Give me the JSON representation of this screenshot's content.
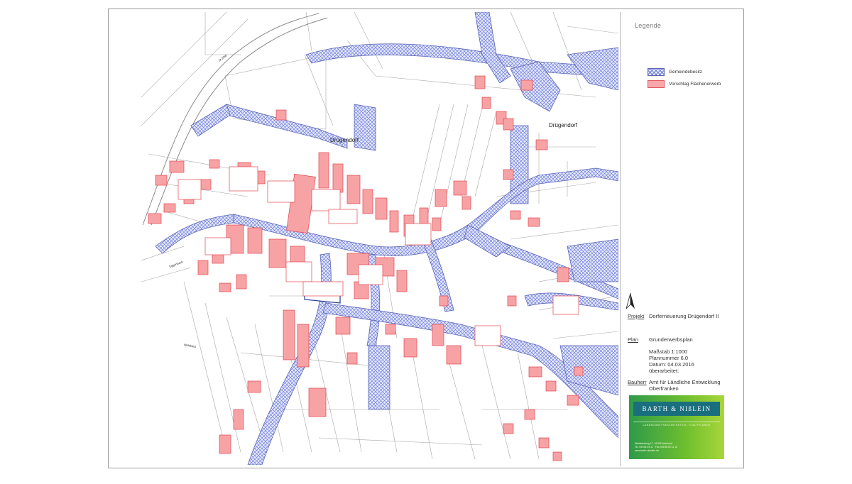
{
  "legend": {
    "title": "Legende",
    "items": [
      {
        "label": "Gemeindebesitz",
        "swatch": "hatch-blue"
      },
      {
        "label": "Vorschlag Flächenerwerb",
        "swatch": "pink"
      }
    ]
  },
  "info": {
    "projekt_label": "Projekt",
    "projekt_value": "Dorferneuerung Drügendorf II",
    "plan_label": "Plan",
    "plan_value": "Grunderwerbsplan",
    "massstab": "Maßstab 1:1000",
    "plannummer": "Plannummer 6.0",
    "datum": "Datum: 04.03.2016",
    "ueberarbeitet": "überarbeitet:",
    "bauherr_label": "Bauherr",
    "bauherr_line1": "Amt für Ländliche Entwicklung",
    "bauherr_line2": "Oberfranken"
  },
  "logo": {
    "name": "BARTH & NIßLEIN",
    "tagline": "LANDSCHAFTSARCHITEKTEN | STADTPLANER",
    "address": "Waldsiedlung 17, 91325 Adelsdorf",
    "phone": "Tel. 09195-93 11 · Fax 09195-93 11 10",
    "web": "www.barth-nisslein.de"
  },
  "map": {
    "labels": [
      {
        "id": "village-label-main",
        "text": "Drügendorf"
      },
      {
        "id": "village-label-east",
        "text": "Drügendorf"
      },
      {
        "id": "street-label-eggenbach",
        "text": "Eggenbach"
      },
      {
        "id": "street-label-muehlbach",
        "text": "Mühlbach"
      },
      {
        "id": "road-label-st",
        "text": "St 2260"
      }
    ]
  },
  "colors": {
    "gemeindebesitz_fill": "#c9d2ff",
    "gemeindebesitz_stroke": "#5b66b5",
    "erwerb_fill": "#f7a3a6",
    "erwerb_stroke": "#e0474f",
    "parcel_line": "#9a9a9a"
  },
  "icons": {
    "north": "north-arrow-icon"
  }
}
